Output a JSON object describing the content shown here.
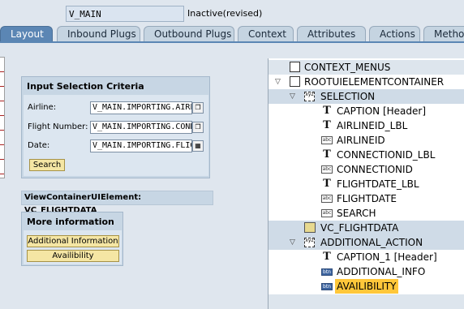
{
  "header": {
    "view_name": "V_MAIN",
    "status": "Inactive(revised)"
  },
  "tabs": [
    {
      "label": "Layout",
      "active": true
    },
    {
      "label": "Inbound Plugs",
      "active": false
    },
    {
      "label": "Outbound Plugs",
      "active": false
    },
    {
      "label": "Context",
      "active": false
    },
    {
      "label": "Attributes",
      "active": false
    },
    {
      "label": "Actions",
      "active": false
    },
    {
      "label": "Methods",
      "active": false
    }
  ],
  "layout": {
    "input_group": {
      "title": "Input Selection Criteria",
      "fields": [
        {
          "label": "Airline:",
          "value": "V_MAIN.IMPORTING.AIRLINEID"
        },
        {
          "label": "Flight Number:",
          "value": "V_MAIN.IMPORTING.CONNECTIONID"
        },
        {
          "label": "Date:",
          "value": "V_MAIN.IMPORTING.FLIGHTDATE"
        }
      ],
      "search_button": "Search"
    },
    "view_container": "ViewContainerUIElement: VC_FLIGHTDATA",
    "more_group": {
      "title": "More information",
      "buttons": [
        "Additional Information",
        "Availibility"
      ]
    }
  },
  "tree": {
    "items": [
      {
        "label": "CONTEXT_MENUS",
        "icon": "box-icon"
      },
      {
        "label": "ROOTUIELEMENTCONTAINER",
        "icon": "box-icon",
        "expanded": true
      },
      {
        "label": "SELECTION",
        "icon": "group-icon",
        "expanded": true
      },
      {
        "label": "CAPTION",
        "hint": "[Header]",
        "icon": "caption-icon"
      },
      {
        "label": "AIRLINEID_LBL",
        "icon": "label-icon"
      },
      {
        "label": "AIRLINEID",
        "icon": "input-icon"
      },
      {
        "label": "CONNECTIONID_LBL",
        "icon": "label-icon"
      },
      {
        "label": "CONNECTIONID",
        "icon": "input-icon"
      },
      {
        "label": "FLIGHTDATE_LBL",
        "icon": "label-icon"
      },
      {
        "label": "FLIGHTDATE",
        "icon": "input-icon"
      },
      {
        "label": "SEARCH",
        "icon": "input-icon"
      },
      {
        "label": "VC_FLIGHTDATA",
        "icon": "view-container-icon"
      },
      {
        "label": "ADDITIONAL_ACTION",
        "icon": "group-icon",
        "expanded": true
      },
      {
        "label": "CAPTION_1",
        "hint": "[Header]",
        "icon": "caption-icon"
      },
      {
        "label": "ADDITIONAL_INFO",
        "icon": "button-icon"
      },
      {
        "label": "AVAILIBILITY",
        "icon": "button-icon",
        "selected": true
      }
    ]
  }
}
